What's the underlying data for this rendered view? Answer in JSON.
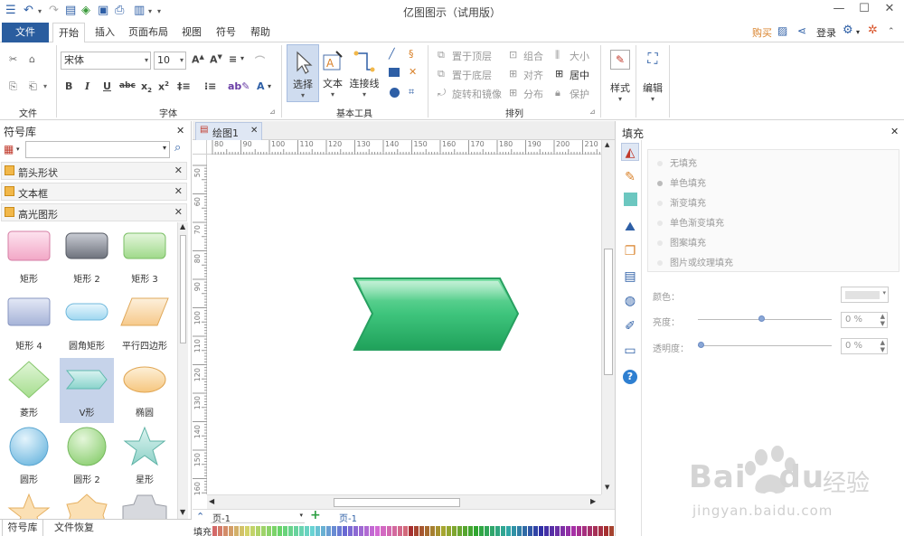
{
  "window": {
    "title": "亿图图示（试用版）"
  },
  "tabs": [
    "文件",
    "开始",
    "插入",
    "页面布局",
    "视图",
    "符号",
    "帮助"
  ],
  "top_right": {
    "buy": "购买",
    "login": "登录"
  },
  "ribbon": {
    "groups": {
      "file": "文件",
      "font": "字体",
      "tools": "基本工具",
      "arrange": "排列"
    },
    "font_name": "宋体",
    "font_size": "10",
    "tools": {
      "select": "选择",
      "text": "文本",
      "connector": "连接线"
    },
    "arrange": {
      "bring_front": "置于顶层",
      "send_back": "置于底层",
      "rotate_mirror": "旋转和镜像",
      "group": "组合",
      "align": "对齐",
      "distribute": "分布",
      "size": "大小",
      "center": "居中",
      "protect": "保护"
    },
    "style": "样式",
    "edit": "编辑"
  },
  "symbol_library": {
    "title": "符号库",
    "search_placeholder": "",
    "categories": [
      "箭头形状",
      "文本框",
      "高光图形"
    ],
    "shapes": [
      {
        "label": "矩形"
      },
      {
        "label": "矩形 2"
      },
      {
        "label": "矩形 3"
      },
      {
        "label": "矩形 4"
      },
      {
        "label": "圆角矩形"
      },
      {
        "label": "平行四边形"
      },
      {
        "label": "菱形"
      },
      {
        "label": "V形"
      },
      {
        "label": "椭圆"
      },
      {
        "label": "圆形"
      },
      {
        "label": "圆形 2"
      },
      {
        "label": "星形"
      }
    ],
    "bottom_tabs": [
      "符号库",
      "文件恢复"
    ]
  },
  "document": {
    "tab_name": "绘图1",
    "ruler_top": [
      "80",
      "90",
      "100",
      "110",
      "120",
      "130",
      "140",
      "150",
      "160",
      "170",
      "180",
      "190",
      "200",
      "210"
    ],
    "ruler_left": [
      "50",
      "60",
      "70",
      "80",
      "90",
      "100",
      "110",
      "120",
      "130",
      "140",
      "150",
      "160"
    ],
    "page_select": "页-1",
    "page_tab": "页-1",
    "fill_label": "填充"
  },
  "fill_panel": {
    "title": "填充",
    "options": [
      "无填充",
      "单色填充",
      "渐变填充",
      "单色渐变填充",
      "图案填充",
      "图片或纹理填充"
    ],
    "color_label": "颜色：",
    "brightness_label": "亮度：",
    "brightness_value": 0.48,
    "brightness_text": "0 %",
    "transparency_label": "透明度：",
    "transparency_value": 0.0,
    "transparency_text": "0 %"
  },
  "colors": {
    "accent": "#2a5d9f",
    "chevron_top": "#7fe0a8",
    "chevron_bottom": "#1fa15a",
    "chevron_stroke": "#27a060"
  },
  "watermark": {
    "brand": "Bai",
    "brand2": "du",
    "cn": "经验",
    "url": "jingyan.baidu.com"
  }
}
